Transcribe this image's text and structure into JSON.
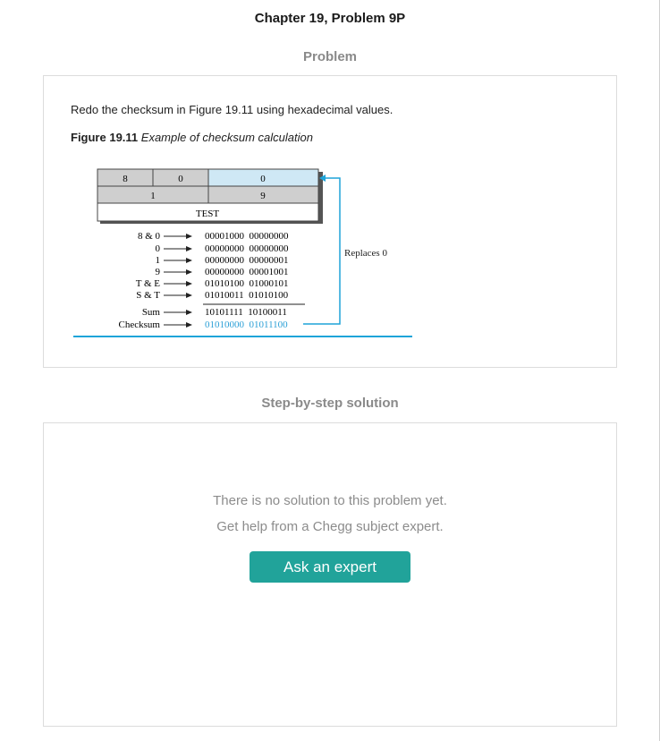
{
  "header": {
    "chapter_title": "Chapter 19, Problem 9P"
  },
  "problem": {
    "section_title": "Problem",
    "text": "Redo the checksum in Figure 19.11 using hexadecimal values.",
    "figure_label": "Figure 19.11",
    "figure_caption": "Example of checksum calculation",
    "figure": {
      "cells": {
        "r1a": "8",
        "r1b": "0",
        "r1c": "0",
        "r2a": "1",
        "r2c": "9",
        "r3": "TEST"
      },
      "rows": [
        {
          "label": "8 & 0",
          "value": "00001000  00000000"
        },
        {
          "label": "0",
          "value": "00000000  00000000"
        },
        {
          "label": "1",
          "value": "00000000  00000001"
        },
        {
          "label": "9",
          "value": "00000000  00001001"
        },
        {
          "label": "T & E",
          "value": "01010100  01000101"
        },
        {
          "label": "S & T",
          "value": "01010011  01010100"
        }
      ],
      "sum_label": "Sum",
      "sum_value": "10101111  10100011",
      "checksum_label": "Checksum",
      "checksum_value": "01010000  01011100",
      "replaces_label": "Replaces 0",
      "colors": {
        "highlight_cell": "#cfe8f5",
        "gray_cell": "#cfcfcf",
        "accent_line": "#1ea4d9",
        "checksum_text": "#2a9fd6"
      }
    }
  },
  "solution": {
    "section_title": "Step-by-step solution",
    "line1": "There is no solution to this problem yet.",
    "line2": "Get help from a Chegg subject expert.",
    "button_label": "Ask an expert",
    "button_color": "#21a39a"
  }
}
